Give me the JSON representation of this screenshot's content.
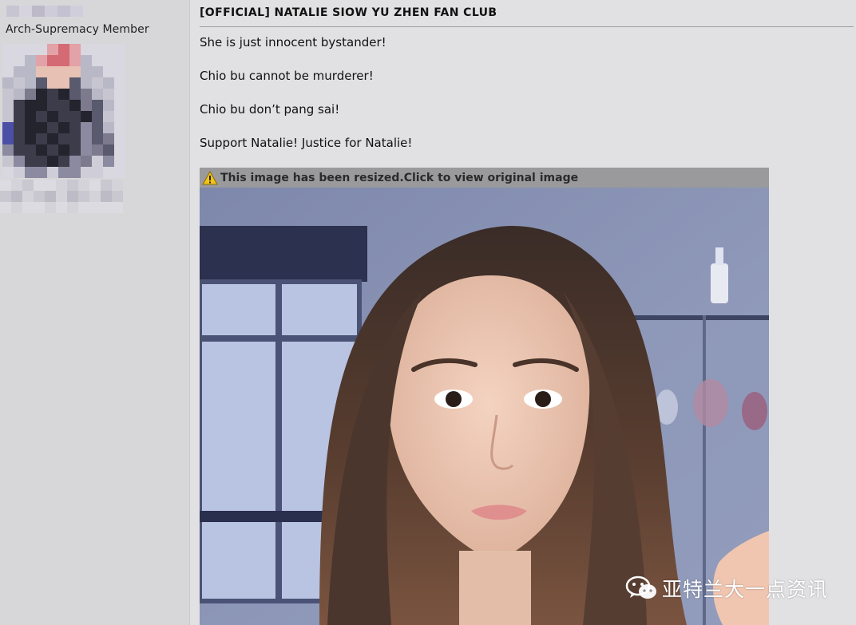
{
  "user": {
    "rank": "Arch-Supremacy Member"
  },
  "post": {
    "title": "[OFFICIAL] NATALIE SIOW YU ZHEN FAN CLUB",
    "lines": [
      "She is just innocent bystander!",
      "Chio bu cannot be murderer!",
      "Chio bu don’t pang sai!",
      "Support Natalie! Justice for Natalie!"
    ],
    "image_notice": "This image has been resized.Click to view original image",
    "image_notice_icon": "warning-icon"
  },
  "watermark": {
    "text": "亚特兰大一点资讯",
    "icon": "wechat-icon"
  },
  "colors": {
    "page_bg": "#e1e1e3",
    "left_panel_bg": "#d7d7d9",
    "notice_bar": "#9a9a9c",
    "warning_yellow": "#f2c31b"
  }
}
